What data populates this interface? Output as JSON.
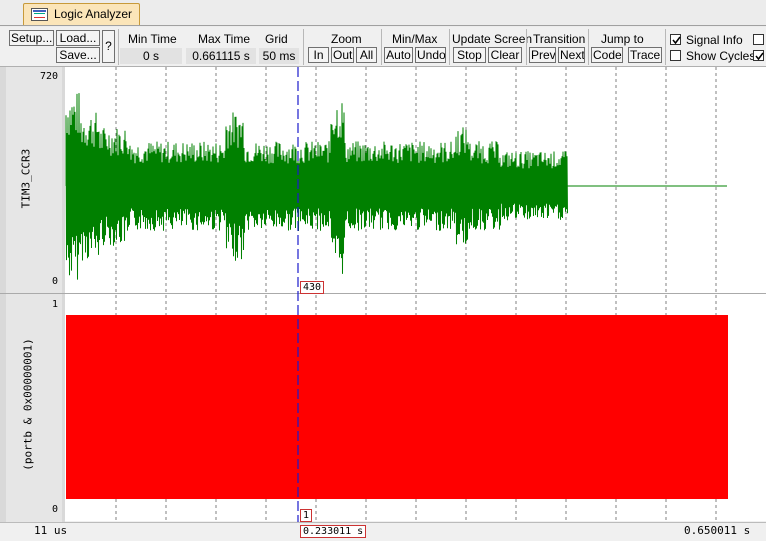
{
  "tab": {
    "title": "Logic Analyzer",
    "icon": "logic-analyzer-icon"
  },
  "toolbar": {
    "setup": "Setup...",
    "load": "Load...",
    "save": "Save...",
    "help": "?",
    "min_time_label": "Min Time",
    "min_time_value": "0 s",
    "max_time_label": "Max Time",
    "max_time_value": "0.661115 s",
    "grid_label": "Grid",
    "grid_value": "50 ms",
    "zoom_label": "Zoom",
    "zoom_in": "In",
    "zoom_out": "Out",
    "zoom_all": "All",
    "minmax_label": "Min/Max",
    "minmax_auto": "Auto",
    "minmax_undo": "Undo",
    "update_label": "Update Screen",
    "update_stop": "Stop",
    "update_clear": "Clear",
    "transition_label": "Transition",
    "transition_prev": "Prev",
    "transition_next": "Next",
    "jump_label": "Jump to",
    "jump_code": "Code",
    "jump_trace": "Trace",
    "signal_info_label": "Signal Info",
    "signal_info_checked": true,
    "show_cycles_label": "Show Cycles",
    "show_cycles_checked": false,
    "right_check_1": false,
    "right_check_2": true
  },
  "signals": [
    {
      "name": "TIM3_CCR3",
      "max": "720",
      "min": "0",
      "color": "#008000"
    },
    {
      "name": "(portb & 0x00000001)",
      "max": "1",
      "min": "0",
      "color": "#ff0000"
    }
  ],
  "cursor": {
    "value_analog": "430",
    "value_digital": "1",
    "time": "0.233011  s",
    "color": "#0000cc"
  },
  "timebar": {
    "start": "11 us",
    "end": "0.650011  s"
  },
  "colors": {
    "analog": "#008000",
    "digital": "#ff0000",
    "grid": "#808080",
    "cursor": "#1a1acc"
  }
}
